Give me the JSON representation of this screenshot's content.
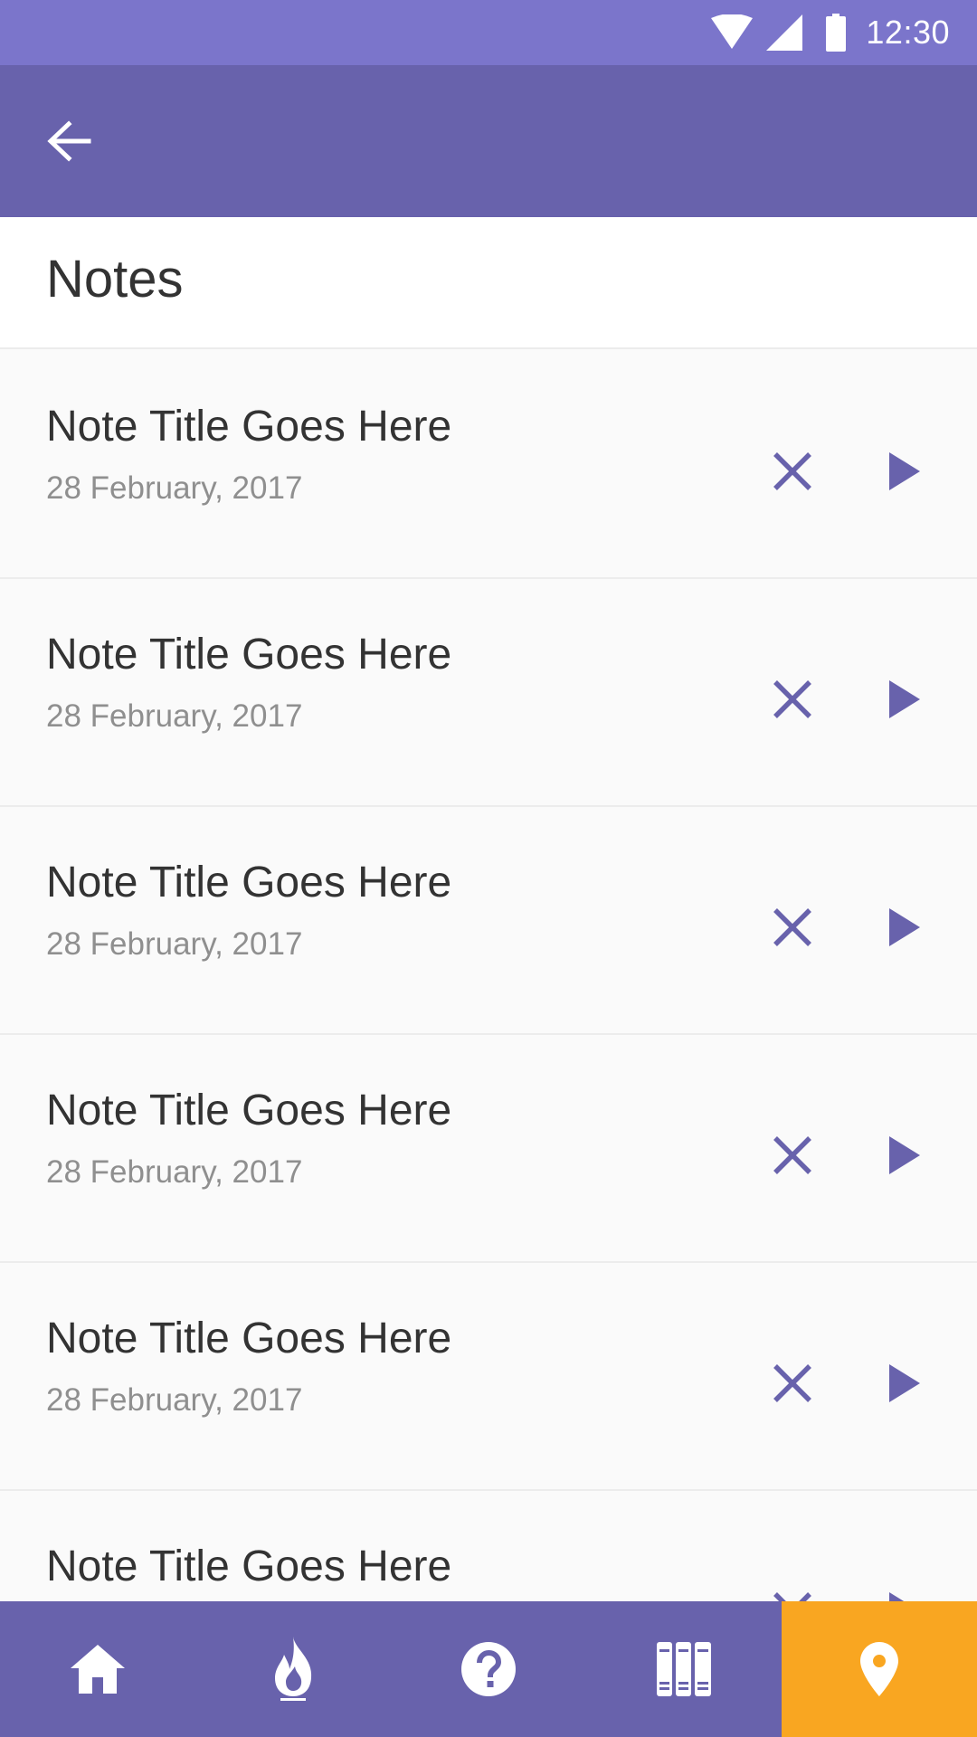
{
  "status_bar": {
    "time": "12:30",
    "icons": [
      "wifi-icon",
      "cell-signal-icon",
      "battery-icon"
    ]
  },
  "app_bar": {
    "back_icon": "arrow-left-icon"
  },
  "page": {
    "title": "Notes"
  },
  "notes": [
    {
      "title": "Note Title Goes Here",
      "date": "28 February, 2017"
    },
    {
      "title": "Note Title Goes Here",
      "date": "28 February, 2017"
    },
    {
      "title": "Note Title Goes Here",
      "date": "28 February, 2017"
    },
    {
      "title": "Note Title Goes Here",
      "date": "28 February, 2017"
    },
    {
      "title": "Note Title Goes Here",
      "date": "28 February, 2017"
    },
    {
      "title": "Note Title Goes Here",
      "date": ""
    }
  ],
  "note_actions": {
    "delete_icon": "close-icon",
    "open_icon": "play-arrow-icon"
  },
  "bottom_nav": {
    "items": [
      {
        "icon": "home-icon",
        "active": false
      },
      {
        "icon": "flame-icon",
        "active": false
      },
      {
        "icon": "help-circle-icon",
        "active": false
      },
      {
        "icon": "library-books-icon",
        "active": false
      },
      {
        "icon": "location-pin-icon",
        "active": true
      }
    ]
  },
  "colors": {
    "status_bar": "#7b75cb",
    "app_bar": "#6862ac",
    "accent": "#6862ac",
    "active_tab": "#f9a621",
    "title_text": "#333333",
    "date_text": "#8f8f8f",
    "background": "#fafafa"
  }
}
